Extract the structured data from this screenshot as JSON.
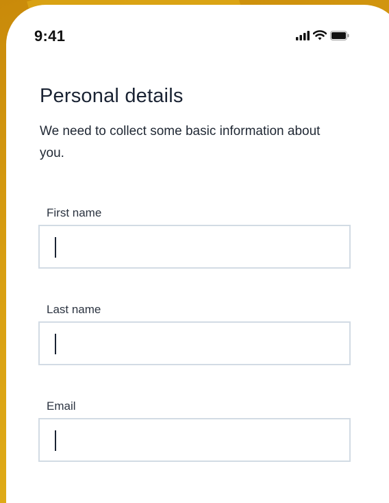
{
  "status_bar": {
    "time": "9:41",
    "icons": [
      "cellular-signal-icon",
      "wifi-icon",
      "battery-icon"
    ]
  },
  "page": {
    "title": "Personal details",
    "subtitle": "We need to collect some basic information about you."
  },
  "form": {
    "first_name": {
      "label": "First name",
      "value": ""
    },
    "last_name": {
      "label": "Last name",
      "value": ""
    },
    "email": {
      "label": "Email",
      "value": ""
    }
  },
  "colors": {
    "background_accent": "#d9a012",
    "input_border": "#d2dbe4",
    "text_primary": "#1a2333"
  }
}
